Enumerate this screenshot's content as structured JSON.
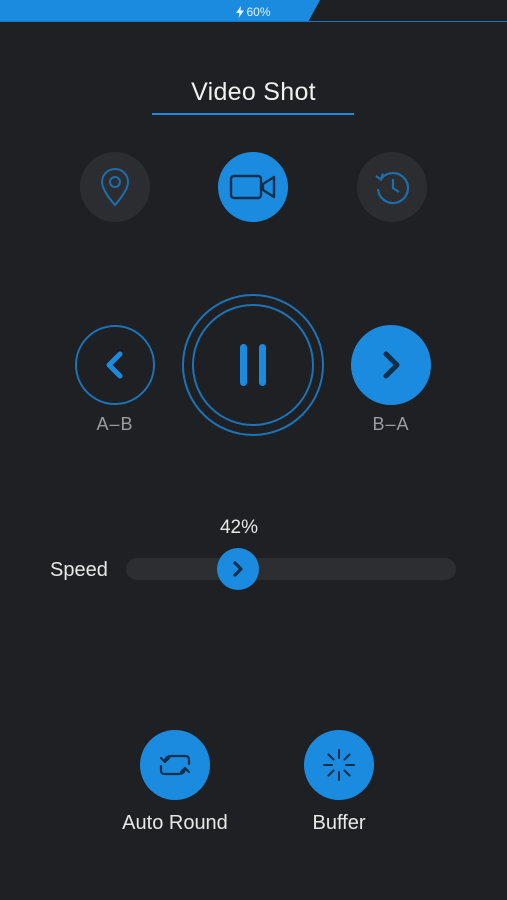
{
  "status": {
    "battery_label": "60%",
    "battery_level": 0.6
  },
  "header": {
    "title": "Video Shot"
  },
  "modes": [
    {
      "icon": "location-pin-icon",
      "active": false
    },
    {
      "icon": "video-camera-icon",
      "active": true
    },
    {
      "icon": "timelapse-history-icon",
      "active": false
    }
  ],
  "controls": {
    "left_label": "A–B",
    "right_label": "B–A",
    "center_icon": "pause-icon"
  },
  "speed": {
    "label": "Speed",
    "value_text": "42%",
    "value": 0.42
  },
  "actions": {
    "auto_round_label": "Auto Round",
    "buffer_label": "Buffer"
  },
  "colors": {
    "accent": "#1b8be0",
    "background": "#1f2023",
    "muted_button": "#2b2d31"
  }
}
